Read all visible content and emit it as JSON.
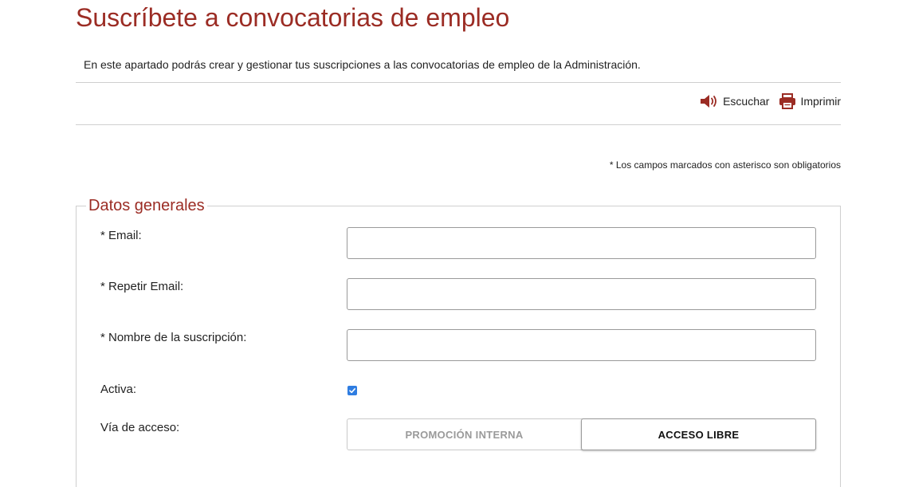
{
  "header": {
    "title": "Suscríbete a convocatorias de empleo",
    "intro": "En este apartado podrás crear y gestionar tus suscripciones a las convocatorias de empleo de la Administración."
  },
  "tools": {
    "listen_label": "Escuchar",
    "print_label": "Imprimir"
  },
  "required_note": "* Los campos marcados con asterisco son obligatorios",
  "form": {
    "legend": "Datos generales",
    "email_label": "* Email:",
    "email_value": "",
    "repeat_email_label": "* Repetir Email:",
    "repeat_email_value": "",
    "subscription_name_label": "* Nombre de la suscripción:",
    "subscription_name_value": "",
    "active_label": "Activa:",
    "active_checked": true,
    "access_label": "Vía de acceso:",
    "access_options": [
      "PROMOCIÓN INTERNA",
      "ACCESO LIBRE"
    ],
    "access_selected": "ACCESO LIBRE"
  },
  "colors": {
    "accent": "#9b2c24",
    "checkbox": "#2f7de1",
    "border": "#cfcfcf"
  },
  "icons": {
    "listen": "speaker-icon",
    "print": "printer-icon",
    "check": "check-icon"
  }
}
